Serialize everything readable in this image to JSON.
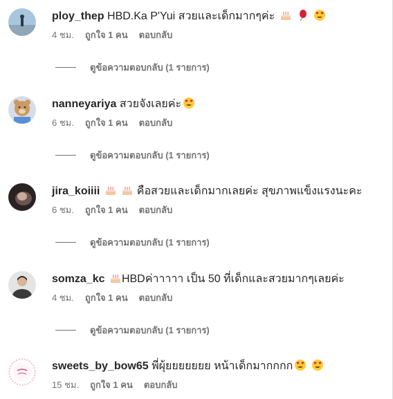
{
  "comments": [
    {
      "username": "ploy_thep",
      "text": "HBD.Ka P'Yui สวยและเด็กมากๆค่ะ",
      "emojis": [
        "cake-icon",
        "balloon-icon",
        "heart-eyes-icon"
      ],
      "time": "4 ชม.",
      "likes": "ถูกใจ 1 คน",
      "reply_label": "ตอบกลับ",
      "view_replies": "ดูข้อความตอบกลับ (1 รายการ)"
    },
    {
      "username": "nanneyariya",
      "text": "สวยจังเลยค่ะ",
      "emojis": [
        "heart-eyes-icon"
      ],
      "time": "6 ชม.",
      "likes": "ถูกใจ 1 คน",
      "reply_label": "ตอบกลับ",
      "view_replies": "ดูข้อความตอบกลับ (1 รายการ)"
    },
    {
      "username": "jira_koiiii",
      "text": "คือสวยและเด็กมากเลยค่ะ สุขภาพแข็งแรงนะคะ",
      "emojis_before": [
        "cake-icon",
        "cake-icon"
      ],
      "time": "6 ชม.",
      "likes": "ถูกใจ 1 คน",
      "reply_label": "ตอบกลับ",
      "view_replies": "ดูข้อความตอบกลับ (1 รายการ)"
    },
    {
      "username": "somza_kc",
      "text": "HBDค่าาาาา เป็น 50 ที่เด็กและสวยมากๆเลยค่ะ",
      "emojis_before": [
        "cake-icon"
      ],
      "time": "4 ชม.",
      "likes": "ถูกใจ 1 คน",
      "reply_label": "ตอบกลับ",
      "view_replies": "ดูข้อความตอบกลับ (1 รายการ)"
    },
    {
      "username": "sweets_by_bow65",
      "text": "พี่ผุ้ยยยยยยย หน้าเด็กมากกกก",
      "emojis": [
        "heart-eyes-icon",
        "heart-eyes-icon"
      ],
      "time": "15 ชม.",
      "likes": "ถูกใจ 1 คน",
      "reply_label": "ตอบกลับ"
    }
  ],
  "colors": {
    "text": "#262626",
    "secondary": "#737373",
    "background": "#ffffff"
  }
}
